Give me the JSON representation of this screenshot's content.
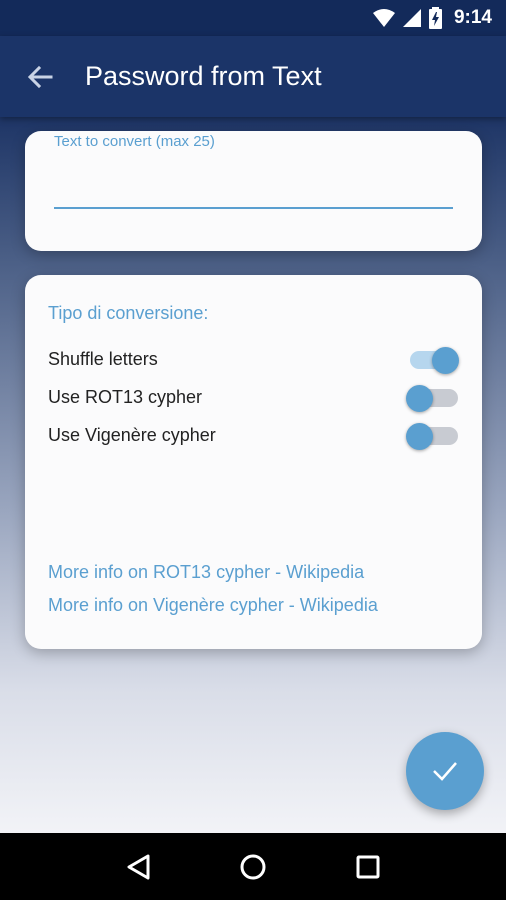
{
  "status_bar": {
    "time": "9:14"
  },
  "app_bar": {
    "title": "Password from Text"
  },
  "input_card": {
    "label": "Text to convert (max 25)",
    "value": ""
  },
  "options_card": {
    "section_title": "Tipo di conversione:",
    "options": [
      {
        "label": "Shuffle letters",
        "enabled": true
      },
      {
        "label": "Use ROT13 cypher",
        "enabled": false
      },
      {
        "label": "Use Vigenère cypher",
        "enabled": false
      }
    ],
    "links": [
      "More info on ROT13 cypher - Wikipedia",
      "More info on Vigenère cypher - Wikipedia"
    ]
  },
  "colors": {
    "accent": "#5a9fd0",
    "app_bar": "#1b3468",
    "status_bar": "#132a5a"
  },
  "icons": {
    "back": "arrow-left-icon",
    "fab": "check-icon",
    "nav_back": "triangle-back-icon",
    "nav_home": "circle-home-icon",
    "nav_recents": "square-recents-icon"
  }
}
